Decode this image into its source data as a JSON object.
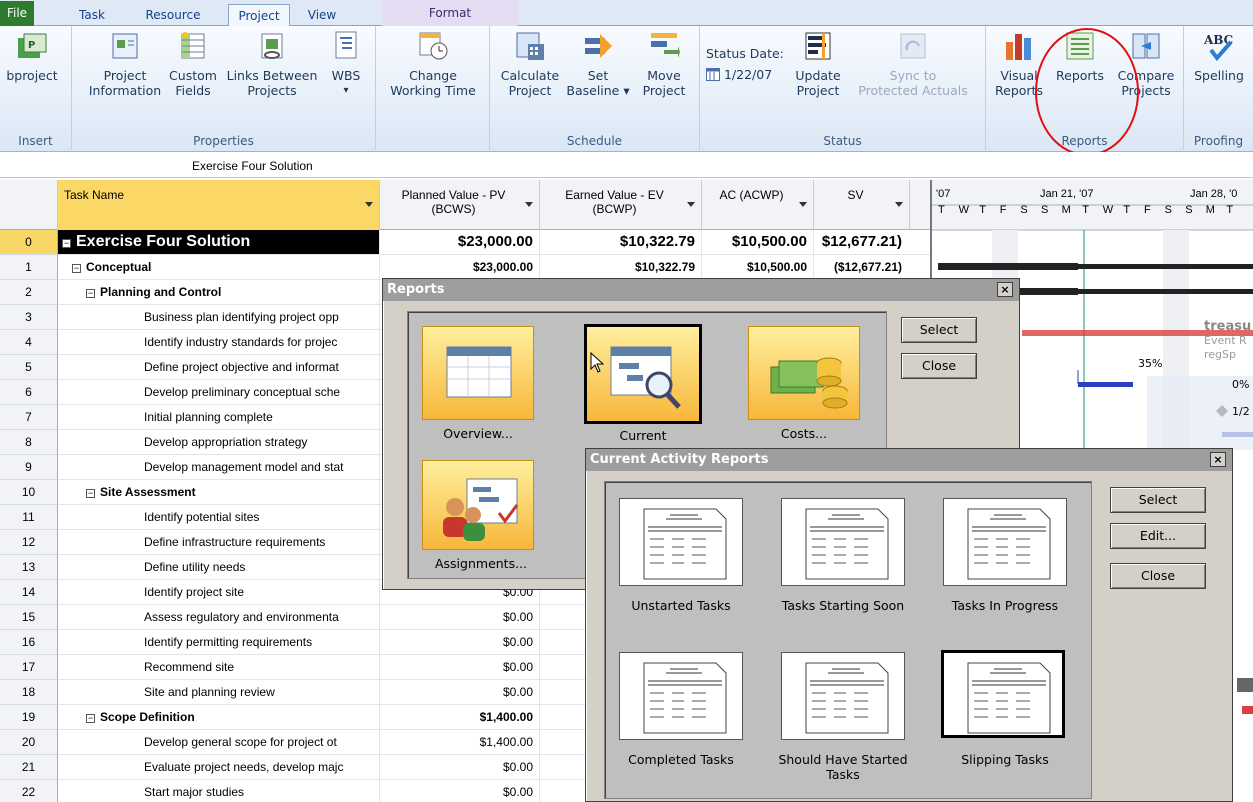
{
  "tabs": [
    "File",
    "Task",
    "Resource",
    "Project",
    "View",
    "Format"
  ],
  "ribbon": {
    "groups": {
      "insert": "Insert",
      "properties": "Properties",
      "schedule": "Schedule",
      "status": "Status",
      "reports": "Reports",
      "proofing": "Proofing"
    },
    "buttons": {
      "subproject": "bproject",
      "project_information": [
        "Project",
        "Information"
      ],
      "custom_fields": [
        "Custom",
        "Fields"
      ],
      "links_between_projects": [
        "Links Between",
        "Projects"
      ],
      "wbs": "WBS",
      "change_working_time": [
        "Change",
        "Working Time"
      ],
      "calculate_project": [
        "Calculate",
        "Project"
      ],
      "set_baseline": [
        "Set",
        "Baseline ▾"
      ],
      "move_project": [
        "Move",
        "Project"
      ],
      "status_date_label": "Status Date:",
      "status_date_value": "1/22/07",
      "update_project": [
        "Update",
        "Project"
      ],
      "sync_protected": [
        "Sync to",
        "Protected Actuals"
      ],
      "visual_reports": [
        "Visual",
        "Reports"
      ],
      "reports": "Reports",
      "compare_projects": [
        "Compare",
        "Projects"
      ],
      "spelling": "Spelling"
    }
  },
  "entry_bar": "Exercise Four Solution",
  "columns": {
    "task_name": "Task Name",
    "pv": [
      "Planned Value - PV",
      "(BCWS)"
    ],
    "ev": [
      "Earned Value - EV",
      "(BCWP)"
    ],
    "ac": "AC (ACWP)",
    "sv": "SV"
  },
  "rows": [
    {
      "id": "0",
      "name": "Exercise Four Solution",
      "level": 0,
      "summary": true,
      "pv": "$23,000.00",
      "ev": "$10,322.79",
      "ac": "$10,500.00",
      "sv": "$12,677.21)"
    },
    {
      "id": "1",
      "name": "Conceptual",
      "level": 1,
      "summary": true,
      "pv": "$23,000.00",
      "ev": "$10,322.79",
      "ac": "$10,500.00",
      "sv": "($12,677.21)"
    },
    {
      "id": "2",
      "name": "Planning and Control",
      "level": 2,
      "summary": true,
      "pv": "",
      "ev": "",
      "ac": "",
      "sv": ""
    },
    {
      "id": "3",
      "name": "Business plan identifying project opp",
      "level": 3,
      "summary": false,
      "pv": "",
      "ev": "",
      "ac": "",
      "sv": ""
    },
    {
      "id": "4",
      "name": "Identify industry standards for projec",
      "level": 3,
      "summary": false,
      "pv": "",
      "ev": "",
      "ac": "",
      "sv": ""
    },
    {
      "id": "5",
      "name": "Define project objective and informat",
      "level": 3,
      "summary": false,
      "pv": "",
      "ev": "",
      "ac": "",
      "sv": ""
    },
    {
      "id": "6",
      "name": "Develop preliminary conceptual sche",
      "level": 3,
      "summary": false,
      "pv": "",
      "ev": "",
      "ac": "",
      "sv": ""
    },
    {
      "id": "7",
      "name": "Initial planning complete",
      "level": 3,
      "summary": false,
      "pv": "",
      "ev": "",
      "ac": "",
      "sv": ""
    },
    {
      "id": "8",
      "name": "Develop appropriation strategy",
      "level": 3,
      "summary": false,
      "pv": "",
      "ev": "",
      "ac": "",
      "sv": ""
    },
    {
      "id": "9",
      "name": "Develop management model and stat",
      "level": 3,
      "summary": false,
      "pv": "",
      "ev": "",
      "ac": "",
      "sv": ""
    },
    {
      "id": "10",
      "name": "Site Assessment",
      "level": 2,
      "summary": true,
      "pv": "",
      "ev": "",
      "ac": "",
      "sv": ""
    },
    {
      "id": "11",
      "name": "Identify potential sites",
      "level": 3,
      "summary": false,
      "pv": "",
      "ev": "",
      "ac": "",
      "sv": ""
    },
    {
      "id": "12",
      "name": "Define infrastructure requirements",
      "level": 3,
      "summary": false,
      "pv": "",
      "ev": "",
      "ac": "",
      "sv": ""
    },
    {
      "id": "13",
      "name": "Define utility needs",
      "level": 3,
      "summary": false,
      "pv": "",
      "ev": "",
      "ac": "",
      "sv": ""
    },
    {
      "id": "14",
      "name": "Identify project site",
      "level": 3,
      "summary": false,
      "pv": "$0.00",
      "ev": "",
      "ac": "",
      "sv": ""
    },
    {
      "id": "15",
      "name": "Assess regulatory and environmenta",
      "level": 3,
      "summary": false,
      "pv": "$0.00",
      "ev": "",
      "ac": "",
      "sv": ""
    },
    {
      "id": "16",
      "name": "Identify permitting requirements",
      "level": 3,
      "summary": false,
      "pv": "$0.00",
      "ev": "",
      "ac": "",
      "sv": ""
    },
    {
      "id": "17",
      "name": "Recommend site",
      "level": 3,
      "summary": false,
      "pv": "$0.00",
      "ev": "",
      "ac": "",
      "sv": ""
    },
    {
      "id": "18",
      "name": "Site and planning review",
      "level": 3,
      "summary": false,
      "pv": "$0.00",
      "ev": "",
      "ac": "",
      "sv": ""
    },
    {
      "id": "19",
      "name": "Scope Definition",
      "level": 2,
      "summary": true,
      "pv": "$1,400.00",
      "ev": "",
      "ac": "",
      "sv": ""
    },
    {
      "id": "20",
      "name": "Develop general scope for project ot",
      "level": 3,
      "summary": false,
      "pv": "$1,400.00",
      "ev": "",
      "ac": "",
      "sv": ""
    },
    {
      "id": "21",
      "name": "Evaluate project needs, develop majc",
      "level": 3,
      "summary": false,
      "pv": "$0.00",
      "ev": "",
      "ac": "",
      "sv": ""
    },
    {
      "id": "22",
      "name": "Start major studies",
      "level": 3,
      "summary": false,
      "pv": "$0.00",
      "ev": "",
      "ac": "",
      "sv": ""
    }
  ],
  "gantt": {
    "timescale": [
      "'07",
      "Jan 21, '07",
      "Jan 28, '0"
    ],
    "days": [
      "T",
      "W",
      "T",
      "F",
      "S",
      "S",
      "M",
      "T",
      "W",
      "T",
      "F",
      "S",
      "S",
      "M",
      "T"
    ],
    "labels": {
      "pct1": "35%",
      "pct2": "0%",
      "pct3": "1/2"
    },
    "ghost_text": [
      "treasu",
      "Event R",
      "regSp"
    ]
  },
  "reports_dialog": {
    "title": "Reports",
    "close_x": "×",
    "tiles": [
      "Overview...",
      "Current",
      "Costs...",
      "Assignments..."
    ],
    "select": "Select",
    "close": "Close"
  },
  "current_dialog": {
    "title": "Current Activity Reports",
    "close_x": "×",
    "items": [
      "Unstarted Tasks",
      "Tasks Starting Soon",
      "Tasks In Progress",
      "Completed Tasks",
      "Should Have Started Tasks",
      "Slipping Tasks"
    ],
    "select": "Select",
    "edit": "Edit...",
    "close": "Close"
  },
  "colors": {
    "file_tab": "#2d7b2f",
    "highlight_circle": "#e01010",
    "selected_row": "#f9d766"
  }
}
